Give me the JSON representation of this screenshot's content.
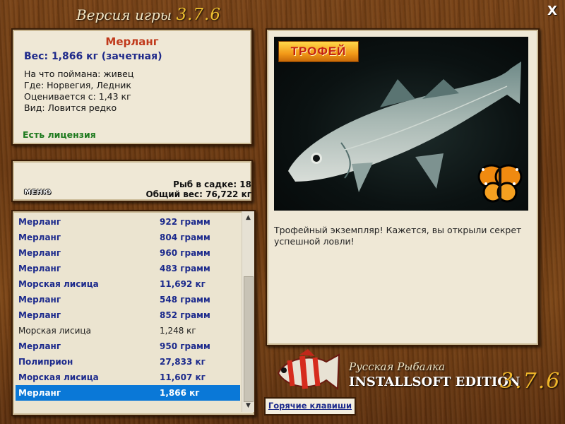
{
  "window": {
    "title_prefix": "Версия игры",
    "title_version": "3.7.6",
    "close_glyph": "X"
  },
  "catch": {
    "name": "Мерланг",
    "weight_line": "Вес: 1,866 кг (зачетная)",
    "bait": "На что поймана: живец",
    "location": "Где: Норвегия, Ледник",
    "rated_from": "Оценивается с: 1,43 кг",
    "rarity": "Вид: Ловится редко",
    "license": "Есть лицензия"
  },
  "cage": {
    "menu_label": "МЕНЮ",
    "fish_count": "Рыб в садке: 18",
    "total_weight": "Общий вес: 76,722 кг"
  },
  "fish_list": [
    {
      "name": "Мерланг",
      "weight": "922 грамм",
      "style": "bold"
    },
    {
      "name": "Мерланг",
      "weight": "804 грамм",
      "style": "bold"
    },
    {
      "name": "Мерланг",
      "weight": "960 грамм",
      "style": "bold"
    },
    {
      "name": "Мерланг",
      "weight": "483 грамм",
      "style": "bold"
    },
    {
      "name": "Морская лисица",
      "weight": "11,692 кг",
      "style": "bold"
    },
    {
      "name": "Мерланг",
      "weight": "548 грамм",
      "style": "bold"
    },
    {
      "name": "Мерланг",
      "weight": "852 грамм",
      "style": "bold"
    },
    {
      "name": "Морская лисица",
      "weight": "1,248 кг",
      "style": "normal"
    },
    {
      "name": "Мерланг",
      "weight": "950 грамм",
      "style": "bold"
    },
    {
      "name": "Полиприон",
      "weight": "27,833 кг",
      "style": "bold"
    },
    {
      "name": "Морская лисица",
      "weight": "11,607 кг",
      "style": "bold"
    },
    {
      "name": "Мерланг",
      "weight": "1,866 кг",
      "style": "sel"
    }
  ],
  "picture": {
    "badge": "ТРОФЕЙ",
    "description": "Трофейный экземпляр! Кажется, вы открыли секрет успешной ловли!"
  },
  "brand": {
    "subtitle": "Русская Рыбалка",
    "edition": "INSTALLSOFT EDITION",
    "version": "3.7.6"
  },
  "hotkeys_label": "Горячие клавиши",
  "icons": [
    "close-icon",
    "scroll-up-icon",
    "scroll-down-icon",
    "butterfly-icon",
    "logo-fish-icon"
  ],
  "colors": {
    "fish_name": "#c0391b",
    "weight": "#1f2a8a",
    "license": "#1e7a1e",
    "selection": "#0a78d7",
    "version_gold": "#f0b62a"
  }
}
